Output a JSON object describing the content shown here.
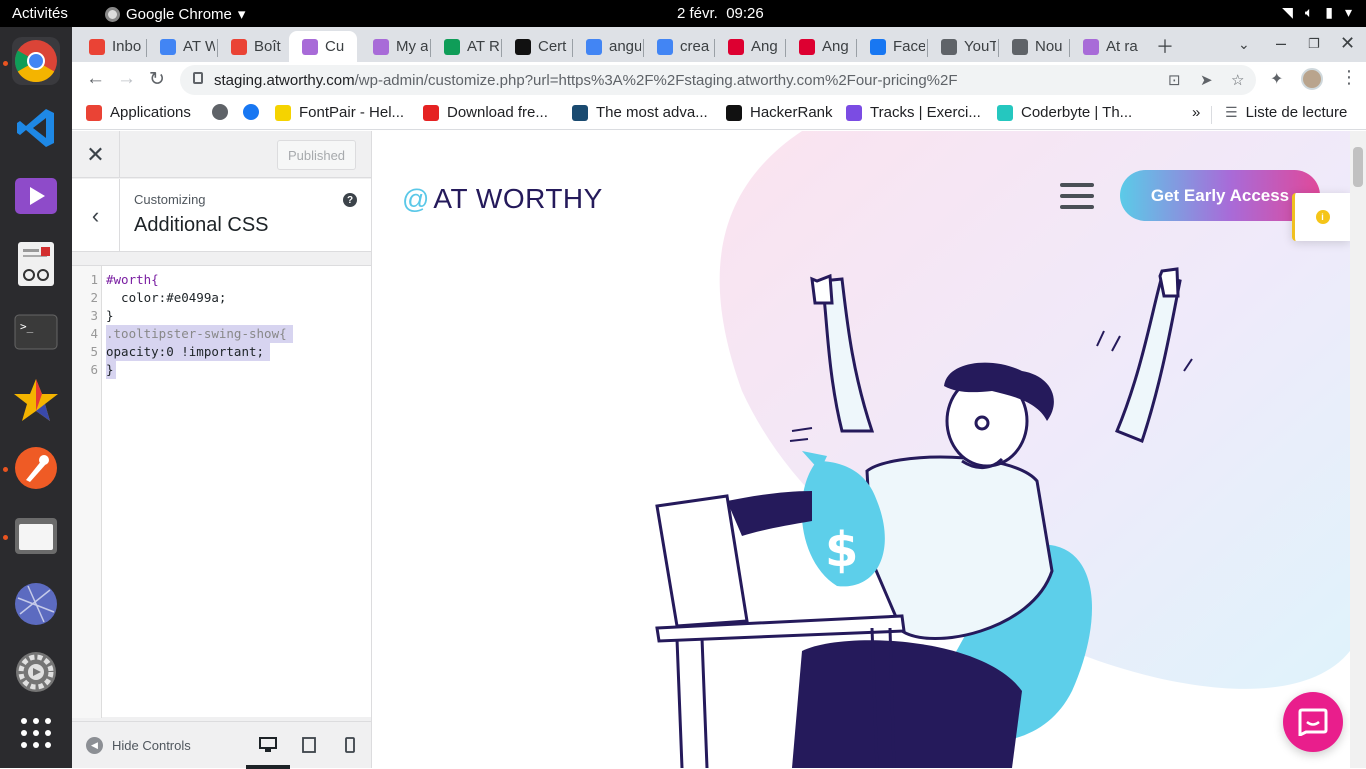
{
  "system": {
    "activities": "Activités",
    "app_name": "Google Chrome",
    "date": "2 févr.",
    "time": "09:26"
  },
  "tabs": [
    {
      "label": "Inbo",
      "favicon": "gmail-icon",
      "color": "#ea4335"
    },
    {
      "label": "AT W",
      "favicon": "calendar-icon",
      "color": "#4285f4"
    },
    {
      "label": "Boît",
      "favicon": "gmail-icon",
      "color": "#ea4335"
    },
    {
      "label": "Cu",
      "favicon": "atworthy-icon",
      "color": "#a86bd8",
      "active": true
    },
    {
      "label": "My a",
      "favicon": "atworthy-icon",
      "color": "#a86bd8"
    },
    {
      "label": "AT R",
      "favicon": "sheets-icon",
      "color": "#0f9d58"
    },
    {
      "label": "Cert",
      "favicon": "b-icon",
      "color": "#111111"
    },
    {
      "label": "angu",
      "favicon": "google-icon",
      "color": "#4285f4"
    },
    {
      "label": "crea",
      "favicon": "google-icon",
      "color": "#4285f4"
    },
    {
      "label": "Ang",
      "favicon": "angular-icon",
      "color": "#dd0031"
    },
    {
      "label": "Ang",
      "favicon": "angular-icon",
      "color": "#dd0031"
    },
    {
      "label": "Face",
      "favicon": "facebook-icon",
      "color": "#1877f2"
    },
    {
      "label": "YouT",
      "favicon": "globe-icon",
      "color": "#5f6368"
    },
    {
      "label": "Nou",
      "favicon": "chrome-icon",
      "color": "#5f6368"
    },
    {
      "label": "At ra",
      "favicon": "atworthy-icon",
      "color": "#a86bd8"
    }
  ],
  "address": {
    "domain": "staging.atworthy.com",
    "path": "/wp-admin/customize.php?url=https%3A%2F%2Fstaging.atworthy.com%2Four-pricing%2F"
  },
  "bookmarks": [
    {
      "label": "Applications",
      "icon": "apps-grid-icon",
      "color": "#ea4335"
    },
    {
      "label": "",
      "icon": "globe-icon",
      "color": "#5f6368"
    },
    {
      "label": "",
      "icon": "facebook-icon",
      "color": "#1877f2"
    },
    {
      "label": "FontPair - Hel...",
      "icon": "fontpair-icon",
      "color": "#f5d300"
    },
    {
      "label": "Download fre...",
      "icon": "hexagon-icon",
      "color": "#e52222"
    },
    {
      "label": "The most adva...",
      "icon": "f-icon",
      "color": "#1a4a70"
    },
    {
      "label": "HackerRank",
      "icon": "hackerrank-icon",
      "color": "#111111"
    },
    {
      "label": "Tracks | Exerci...",
      "icon": "exercism-icon",
      "color": "#7b4ce3"
    },
    {
      "label": "Coderbyte | Th...",
      "icon": "coderbyte-icon",
      "color": "#25c7bf"
    }
  ],
  "bookmarks_overflow": "»",
  "reading_list": "Liste de lecture",
  "customizer": {
    "publish_label": "Published",
    "subtitle": "Customizing",
    "title": "Additional CSS",
    "help": "?",
    "hide_controls": "Hide Controls",
    "code": [
      "#worth{",
      "  color:#e0499a;",
      "}",
      ".tooltipster-swing-show{",
      "opacity:0 !important;",
      "}"
    ]
  },
  "preview": {
    "logo_at": "@",
    "logo_text": "AT WORTHY",
    "cta": "Get Early Access",
    "brand_pink": "#e0499a",
    "brand_cyan": "#5bcbe8",
    "brand_navy": "#251a5b"
  }
}
